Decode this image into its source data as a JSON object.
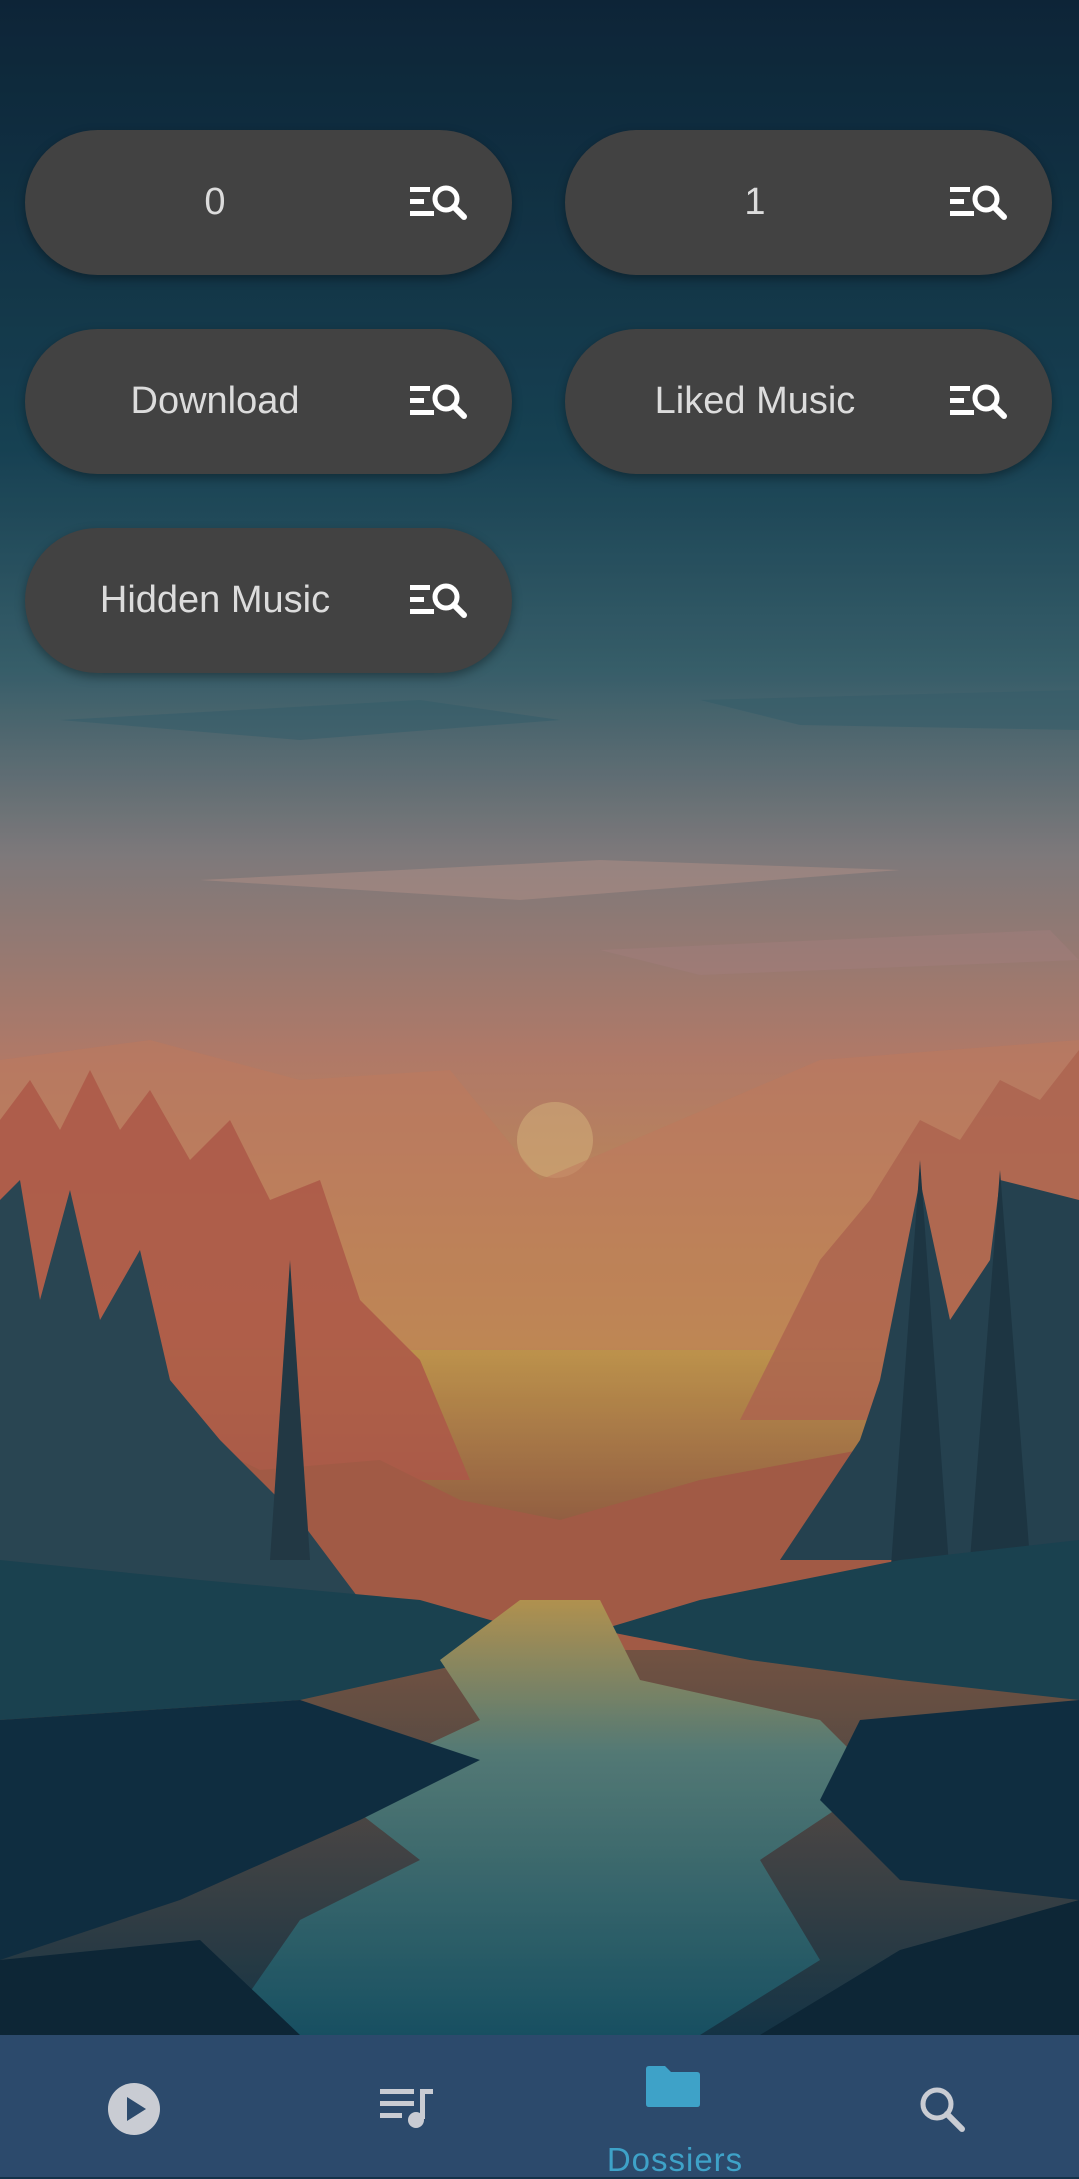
{
  "colors": {
    "button_bg": "#424242",
    "button_text": "#dcdcdc",
    "nav_bg": "#2c4a6c",
    "nav_active": "#3ea2c8",
    "nav_inactive": "#c9ccd3"
  },
  "folders": [
    {
      "label": "0",
      "icon": "playlist-search-icon"
    },
    {
      "label": "1",
      "icon": "playlist-search-icon"
    },
    {
      "label": "Download",
      "icon": "playlist-search-icon"
    },
    {
      "label": "Liked Music",
      "icon": "playlist-search-icon"
    },
    {
      "label": "Hidden Music",
      "icon": "playlist-search-icon"
    }
  ],
  "nav": {
    "items": [
      {
        "icon": "play-circle-icon",
        "active": false
      },
      {
        "icon": "queue-music-icon",
        "active": false
      },
      {
        "icon": "folder-icon",
        "label": "Dossiers",
        "active": true
      },
      {
        "icon": "search-icon",
        "active": false
      }
    ]
  }
}
